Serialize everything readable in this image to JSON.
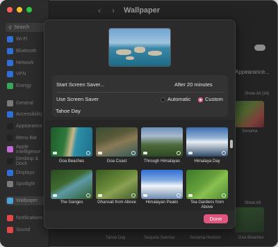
{
  "window": {
    "title": "Wallpaper",
    "traffic_colors": [
      "#ff5f57",
      "#febc2e",
      "#28c840"
    ]
  },
  "sidebar": {
    "search_placeholder": "Search",
    "items": [
      {
        "label": "Wi-Fi",
        "color": "#2f6fd6"
      },
      {
        "label": "Bluetooth",
        "color": "#2f6fd6"
      },
      {
        "label": "Network",
        "color": "#2f6fd6"
      },
      {
        "label": "VPN",
        "color": "#2f6fd6"
      },
      {
        "label": "Energy",
        "color": "#3aa55a"
      },
      {
        "label": "General",
        "color": "#7a7a7a"
      },
      {
        "label": "Accessibility",
        "color": "#2f6fd6"
      },
      {
        "label": "Appearance",
        "color": "#222222"
      },
      {
        "label": "Menu Bar",
        "color": "#222222"
      },
      {
        "label": "Apple Intelligence",
        "color": "#c46ad6"
      },
      {
        "label": "Desktop & Dock",
        "color": "#222222"
      },
      {
        "label": "Displays",
        "color": "#2f6fd6"
      },
      {
        "label": "Spotlight",
        "color": "#7a7a7a"
      },
      {
        "label": "Wallpaper",
        "color": "#4aa4d8",
        "active": true
      },
      {
        "label": "Notifications",
        "color": "#e04848"
      },
      {
        "label": "Sound",
        "color": "#e04848"
      }
    ]
  },
  "background": {
    "appearance_label": "Appearance...",
    "show_all_1": "Show All (34)",
    "sonoma_label": "Sonoma",
    "show_all_2": "Show All",
    "bottom_labels": [
      "Tahoe Day",
      "Sequoia Sunrise",
      "Sonoma Horizon",
      "Goa Beaches"
    ]
  },
  "sheet": {
    "start_label": "Start Screen Saver...",
    "start_value": "After 20 minutes",
    "use_label": "Use Screen Saver",
    "option_automatic": "Automatic",
    "option_custom": "Custom",
    "selected_option": "Custom",
    "current_name": "Tahoe Day",
    "done_label": "Done",
    "accent_color": "#e0567e"
  },
  "savers": [
    {
      "label": "Goa Beaches"
    },
    {
      "label": "Goa Coast"
    },
    {
      "label": "Through Himalayas"
    },
    {
      "label": "Himalaya Day"
    },
    {
      "label": "The Ganges"
    },
    {
      "label": "Ghansali from Above"
    },
    {
      "label": "Himalayan Peaks"
    },
    {
      "label": "Tea Gardens from Above"
    }
  ]
}
